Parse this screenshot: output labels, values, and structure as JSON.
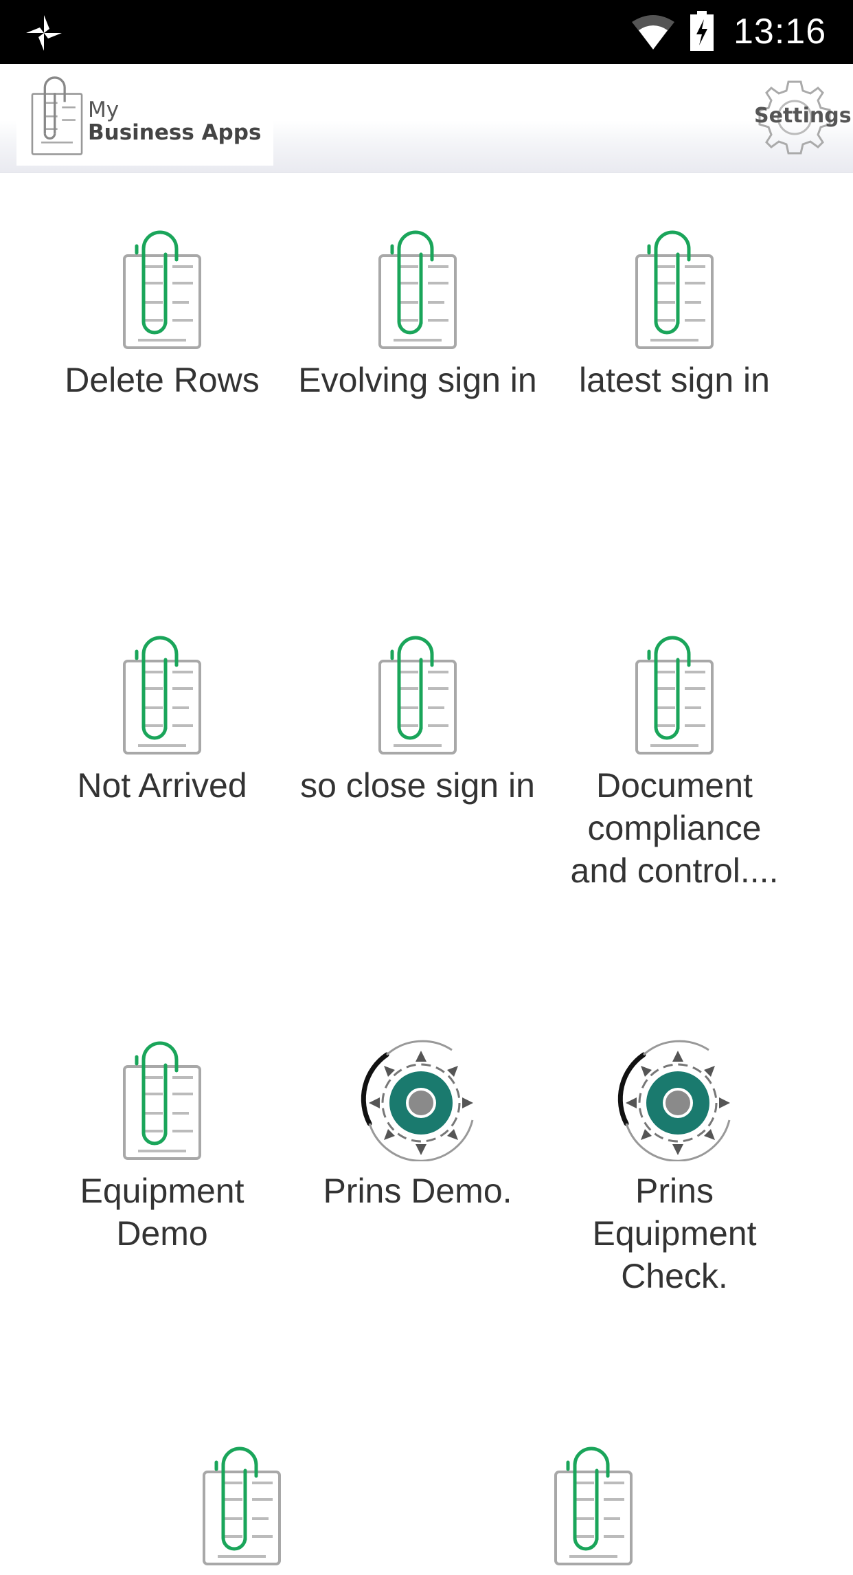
{
  "status_bar": {
    "time": "13:16",
    "icons": [
      "pinwheel-notification-icon",
      "wifi-icon",
      "battery-charging-icon"
    ]
  },
  "header": {
    "logo_line1": "My",
    "logo_line2": "Business Apps",
    "settings_label": "Settings"
  },
  "colors": {
    "paperclip_green": "#1aa55a",
    "gear_teal": "#1a7a6e",
    "doc_gray": "#a8a8a8",
    "label_text": "#333333"
  },
  "apps": [
    {
      "label": "Delete Rows",
      "icon": "paperclip-document-icon"
    },
    {
      "label": "Evolving sign in",
      "icon": "paperclip-document-icon"
    },
    {
      "label": "latest sign in",
      "icon": "paperclip-document-icon"
    },
    {
      "label": "Not Arrived",
      "icon": "paperclip-document-icon"
    },
    {
      "label": "so close sign in",
      "icon": "paperclip-document-icon"
    },
    {
      "label": "Document compliance and control....",
      "icon": "paperclip-document-icon"
    },
    {
      "label": "Equipment Demo",
      "icon": "paperclip-document-icon"
    },
    {
      "label": "Prins Demo.",
      "icon": "gear-cog-icon"
    },
    {
      "label": "Prins Equipment Check.",
      "icon": "gear-cog-icon"
    },
    {
      "label": "",
      "icon": "paperclip-document-icon"
    },
    {
      "label": "",
      "icon": "paperclip-document-icon"
    }
  ]
}
